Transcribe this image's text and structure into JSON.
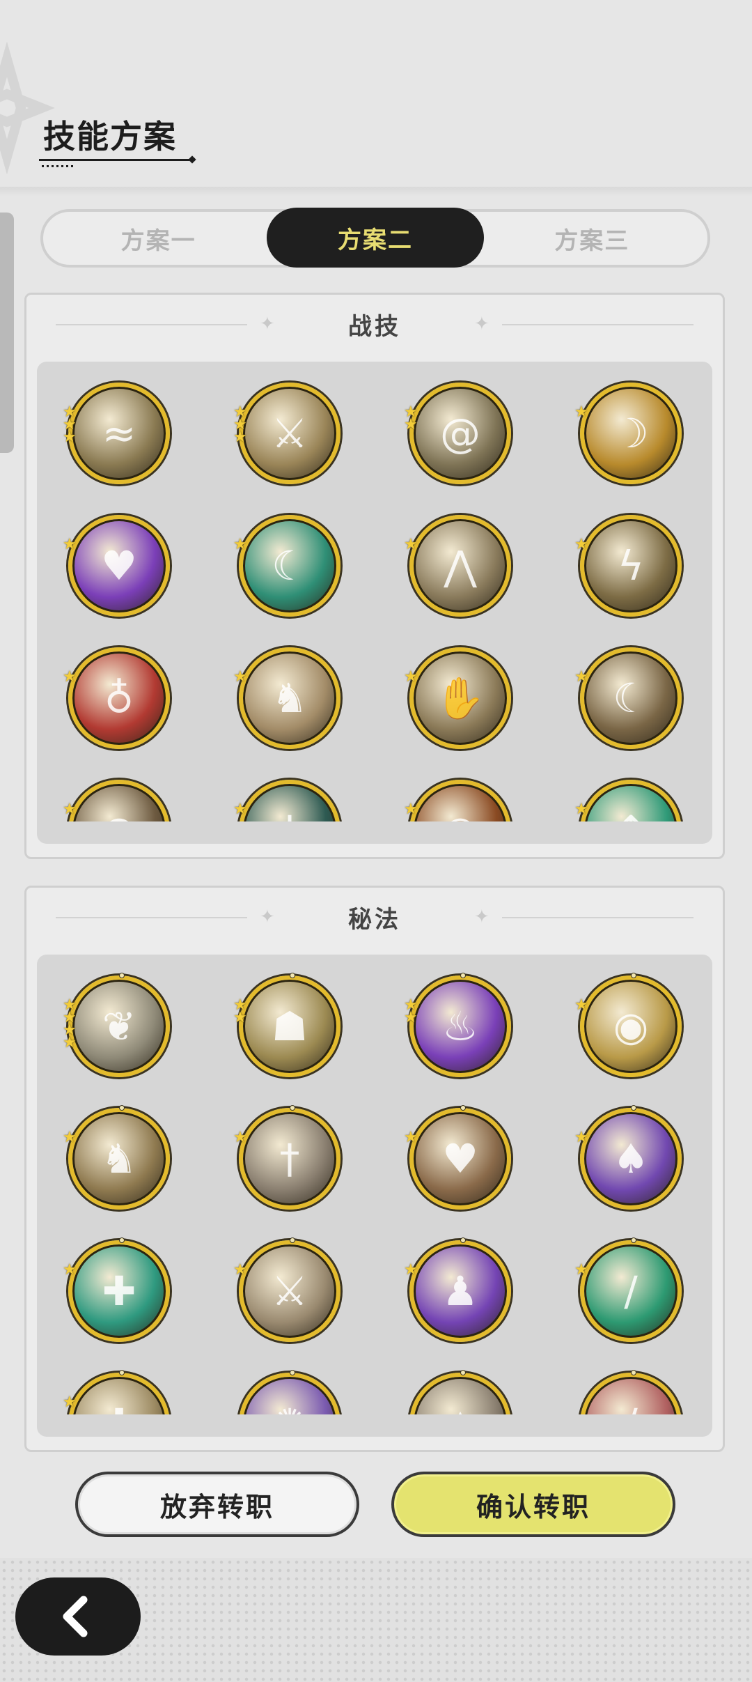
{
  "header": {
    "title": "技能方案"
  },
  "plan_tabs": {
    "items": [
      {
        "label": "方案一",
        "selected": false
      },
      {
        "label": "方案二",
        "selected": true
      },
      {
        "label": "方案三",
        "selected": false
      }
    ]
  },
  "battle_skills": {
    "title": "战技",
    "skills": [
      {
        "icon": "wind-slash-icon",
        "stars": 3,
        "color": "#8a7a52"
      },
      {
        "icon": "sword-strike-icon",
        "stars": 3,
        "color": "#9a8558"
      },
      {
        "icon": "whirlwind-icon",
        "stars": 2,
        "color": "#7f7456"
      },
      {
        "icon": "golden-slash-icon",
        "stars": 1,
        "color": "#b88a2c"
      },
      {
        "icon": "purple-heart-icon",
        "stars": 1,
        "color": "#7b3fb8"
      },
      {
        "icon": "green-wave-icon",
        "stars": 1,
        "color": "#2f8f76"
      },
      {
        "icon": "earth-spikes-icon",
        "stars": 1,
        "color": "#8a7b5c"
      },
      {
        "icon": "lightning-slash-icon",
        "stars": 1,
        "color": "#7d6c45"
      },
      {
        "icon": "fire-figure-icon",
        "stars": 1,
        "color": "#b23a32"
      },
      {
        "icon": "charging-rider-icon",
        "stars": 1,
        "color": "#a38c68"
      },
      {
        "icon": "palm-strike-icon",
        "stars": 1,
        "color": "#8b7a58"
      },
      {
        "icon": "crescent-blade-icon",
        "stars": 1,
        "color": "#7a6646"
      },
      {
        "icon": "leap-strike-icon",
        "stars": 1,
        "color": "#6d5a40"
      },
      {
        "icon": "teal-sword-icon",
        "stars": 1,
        "color": "#2d5a52"
      },
      {
        "icon": "flame-ring-icon",
        "stars": 1,
        "color": "#8a4a22"
      },
      {
        "icon": "green-arrows-icon",
        "stars": 1,
        "color": "#2f9a78"
      }
    ]
  },
  "secret_arts": {
    "title": "秘法",
    "skills": [
      {
        "icon": "leaf-crest-icon",
        "stars": 4,
        "color": "#8f8a78"
      },
      {
        "icon": "golem-icon",
        "stars": 2,
        "color": "#9c8a52"
      },
      {
        "icon": "purple-flame-icon",
        "stars": 2,
        "color": "#7a40b8"
      },
      {
        "icon": "all-seeing-eye-icon",
        "stars": 1,
        "color": "#b99a48"
      },
      {
        "icon": "beast-roar-icon",
        "stars": 1,
        "color": "#8f7a50"
      },
      {
        "icon": "sword-rise-icon",
        "stars": 1,
        "color": "#8a7f70"
      },
      {
        "icon": "heart-shield-icon",
        "stars": 1,
        "color": "#8a6a4a"
      },
      {
        "icon": "shadow-cat-icon",
        "stars": 1,
        "color": "#7148b0"
      },
      {
        "icon": "healing-circle-icon",
        "stars": 1,
        "color": "#2f9a80"
      },
      {
        "icon": "sword-upgrade-icon",
        "stars": 1,
        "color": "#9a8a70"
      },
      {
        "icon": "purple-aura-icon",
        "stars": 1,
        "color": "#7444b4"
      },
      {
        "icon": "green-blade-icon",
        "stars": 1,
        "color": "#2d9a72"
      },
      {
        "icon": "cross-heal-icon",
        "stars": 1,
        "color": "#9c8a62"
      },
      {
        "icon": "purple-orb-icon",
        "stars": 0,
        "color": "#7a5ab0"
      },
      {
        "icon": "arrow-tip-icon",
        "stars": 0,
        "color": "#8a7f70"
      },
      {
        "icon": "red-slash-icon",
        "stars": 0,
        "color": "#b06060"
      }
    ]
  },
  "actions": {
    "cancel_label": "放弃转职",
    "confirm_label": "确认转职"
  },
  "colors": {
    "accent_yellow": "#e4e36f",
    "tab_active_bg": "#1f1f1f",
    "tab_active_text": "#e8dd72",
    "frame_gold": "#e3bb2d"
  }
}
